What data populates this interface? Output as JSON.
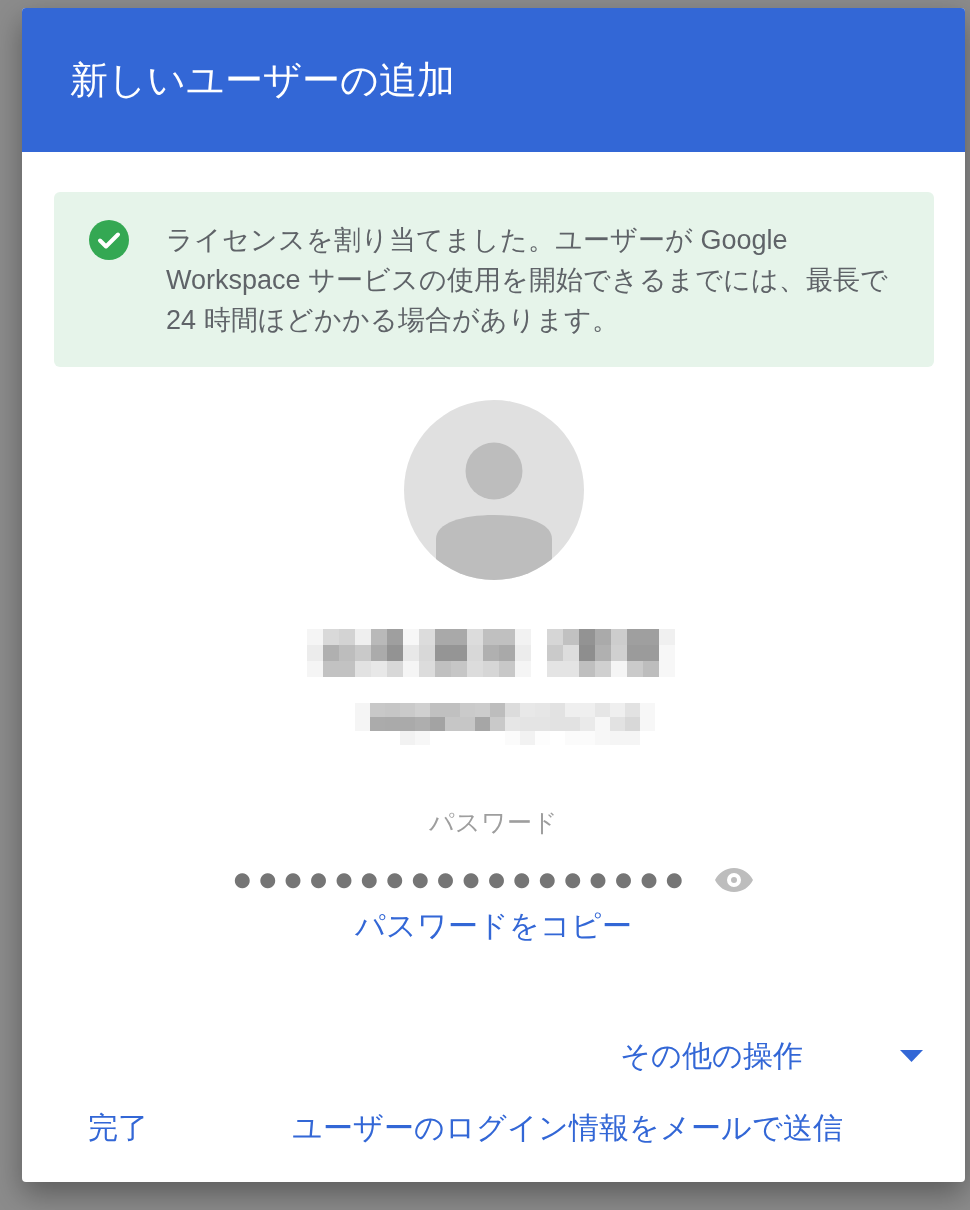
{
  "dialog": {
    "title": "新しいユーザーの追加"
  },
  "notice": {
    "kind": "success",
    "message": "ライセンスを割り当てました。ユーザーが Google Workspace サービスの使用を開始できるまでには、最長で 24 時間ほどかかる場合があります。"
  },
  "password": {
    "label": "パスワード",
    "value": "●●●●●●●●●●●●●●●●●●",
    "copy_link": "パスワードをコピー"
  },
  "more_actions": {
    "label": "その他の操作",
    "expanded": false
  },
  "buttons": [
    "完了",
    "ユーザーのログイン情報をメールで送信"
  ]
}
